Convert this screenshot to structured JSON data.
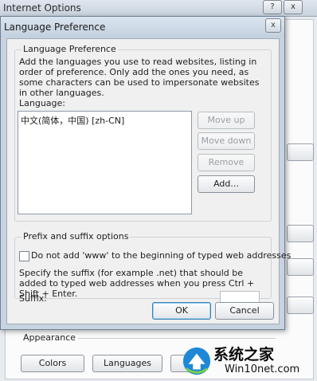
{
  "background_window": {
    "title": "Internet Options",
    "help_glyph": "?",
    "close_glyph": "x",
    "appearance": {
      "label": "Appearance",
      "buttons": [
        "Colors",
        "Languages",
        "F"
      ]
    }
  },
  "dialog": {
    "title": "Language Preference",
    "close_glyph": "x",
    "language_group": {
      "label": "Language Preference",
      "description": "Add the languages you use to read websites, listing in order of preference. Only add the ones you need, as some characters can be used to impersonate websites in other languages.",
      "list_label": "Language:",
      "languages": [
        "中文(简体，中国) [zh-CN]"
      ],
      "buttons": {
        "move_up": "Move up",
        "move_down": "Move down",
        "remove": "Remove",
        "add": "Add..."
      }
    },
    "prefix_group": {
      "label": "Prefix and suffix options",
      "checkbox_label": "Do not add 'www' to the beginning of typed web addresses",
      "checkbox_checked": false,
      "suffix_description": "Specify the suffix (for example .net) that should be added to typed web addresses when you press Ctrl + Shift + Enter.",
      "suffix_label": "Suffix:",
      "suffix_value": ""
    },
    "ok_label": "OK",
    "cancel_label": "Cancel"
  },
  "watermark": {
    "brand_cn": "系统之家",
    "url": "Win10net.com"
  }
}
